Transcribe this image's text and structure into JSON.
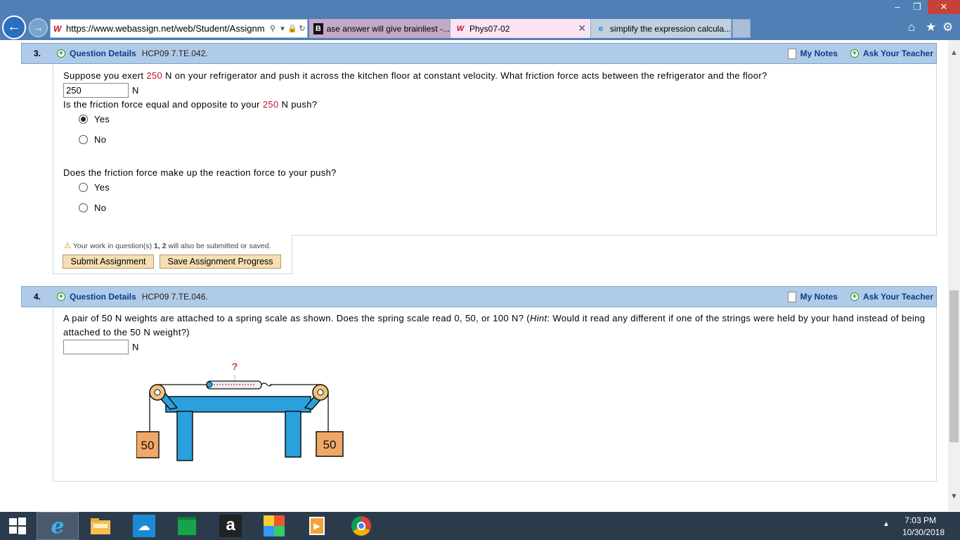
{
  "browser": {
    "url": "https://www.webassign.net/web/Student/Assignm",
    "tabs": [
      {
        "label": "ase answer will give brainliest -..."
      },
      {
        "label": "Phys07-02"
      },
      {
        "label": "simplify the expression calcula..."
      }
    ]
  },
  "q3": {
    "number": "3.",
    "details_label": "Question Details",
    "code": "HCP09 7.TE.042.",
    "my_notes": "My Notes",
    "ask_teacher": "Ask Your Teacher",
    "text1_a": "Suppose you exert ",
    "text1_val": "250",
    "text1_b": " N on your refrigerator and push it across the kitchen floor at constant velocity. What friction force acts between the refrigerator and the floor?",
    "answer_value": "250",
    "unit": "N",
    "text2_a": "Is the friction force equal and opposite to your ",
    "text2_val": "250",
    "text2_b": " N push?",
    "opt_yes": "Yes",
    "opt_no": "No",
    "text3": "Does the friction force make up the reaction force to your push?",
    "opt3_yes": "Yes",
    "opt3_no": "No"
  },
  "submit": {
    "warn_a": "Your work in question(s) ",
    "warn_nums": "1, 2",
    "warn_b": " will also be submitted or saved.",
    "submit_label": "Submit Assignment",
    "save_label": "Save Assignment Progress"
  },
  "q4": {
    "number": "4.",
    "details_label": "Question Details",
    "code": "HCP09 7.TE.046.",
    "my_notes": "My Notes",
    "ask_teacher": "Ask Your Teacher",
    "text_a": "A pair of 50 N weights are attached to a spring scale as shown. Does the spring scale read 0, 50, or 100 N? (",
    "hint_word": "Hint",
    "text_b": ": Would it read any different if one of the strings were held by your hand instead of being attached to the 50 N weight?)",
    "answer_value": "",
    "unit": "N",
    "weight_left": "50",
    "weight_right": "50",
    "question_mark": "?"
  },
  "taskbar": {
    "time": "7:03 PM",
    "date": "10/30/2018"
  },
  "colors": {
    "header_bg": "#b0cbe8",
    "link_blue": "#0a3c8a",
    "value_red": "#c8102e",
    "button_bg": "#f6dfb2"
  }
}
